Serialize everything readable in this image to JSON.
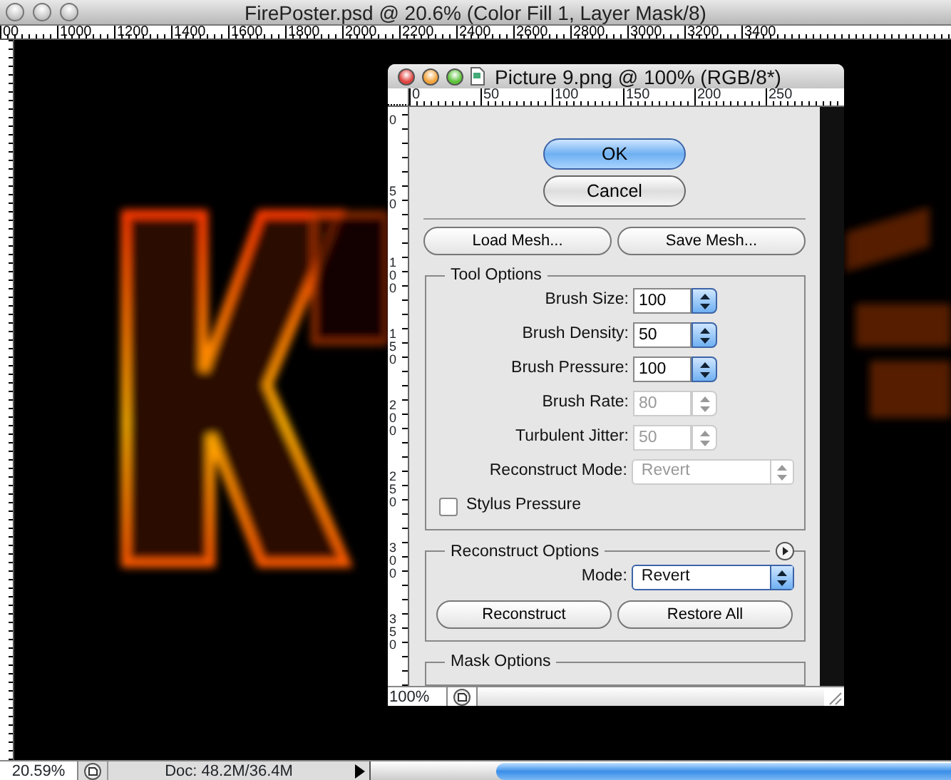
{
  "app_window": {
    "title": "FirePoster.psd @ 20.6% (Color Fill 1, Layer Mask/8)",
    "ruler_labels": [
      "00",
      "1000",
      "1200",
      "1400",
      "1600",
      "1800",
      "2000",
      "2200",
      "2400",
      "2600",
      "2800",
      "3000",
      "3200",
      "3400"
    ],
    "status_bar": {
      "zoom": "20.59%",
      "doc_info": "Doc: 48.2M/36.4M"
    }
  },
  "dialog": {
    "title": "Picture 9.png @ 100% (RGB/8*)",
    "ruler_labels": [
      "0",
      "50",
      "100",
      "150",
      "200",
      "250"
    ],
    "side_ruler_labels": [
      "0",
      "50",
      "100",
      "150",
      "200",
      "250",
      "300",
      "350"
    ],
    "buttons": [
      {
        "label": "OK",
        "default": true
      },
      {
        "label": "Cancel",
        "default": false
      }
    ],
    "mesh_buttons": [
      "Load Mesh...",
      "Save Mesh..."
    ],
    "tool_options": {
      "title": "Tool Options",
      "fields": [
        {
          "kind": "spinner",
          "label": "Brush Size:",
          "value": "100",
          "disabled": false
        },
        {
          "kind": "spinner",
          "label": "Brush Density:",
          "value": "50",
          "disabled": false
        },
        {
          "kind": "spinner",
          "label": "Brush Pressure:",
          "value": "100",
          "disabled": false
        },
        {
          "kind": "spinner",
          "label": "Brush Rate:",
          "value": "80",
          "disabled": true
        },
        {
          "kind": "spinner",
          "label": "Turbulent Jitter:",
          "value": "50",
          "disabled": true
        },
        {
          "kind": "select",
          "label": "Reconstruct Mode:",
          "value": "Revert",
          "disabled": true
        },
        {
          "kind": "checkbox",
          "label": "Stylus Pressure",
          "checked": false
        }
      ]
    },
    "reconstruct_options": {
      "title": "Reconstruct Options",
      "mode_label": "Mode:",
      "mode_value": "Revert",
      "buttons": [
        "Reconstruct",
        "Restore All"
      ]
    },
    "mask_options": {
      "title": "Mask Options"
    },
    "status_bar": {
      "zoom": "100%"
    }
  }
}
